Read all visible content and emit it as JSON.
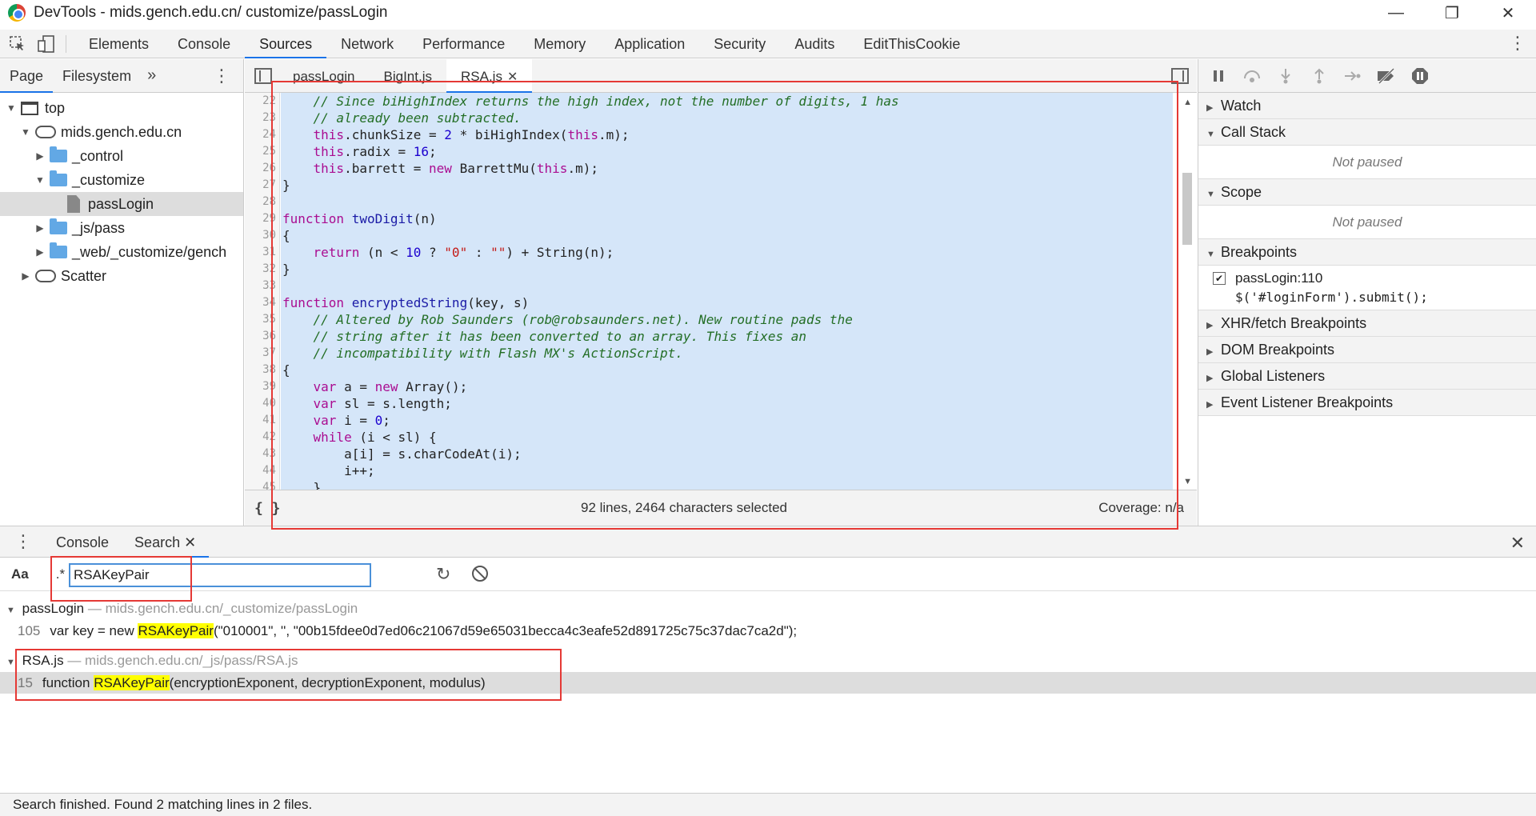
{
  "window": {
    "title": "DevTools - mids.gench.edu.cn/ customize/passLogin",
    "controls": [
      "—",
      "❐",
      "✕"
    ]
  },
  "main_tabs": [
    "Elements",
    "Console",
    "Sources",
    "Network",
    "Performance",
    "Memory",
    "Application",
    "Security",
    "Audits",
    "EditThisCookie"
  ],
  "main_tabs_active": "Sources",
  "navigator": {
    "tabs": [
      "Page",
      "Filesystem"
    ],
    "more": "»",
    "tree": [
      {
        "label": "top",
        "icon": "frame-icon",
        "expanded": true
      },
      {
        "label": "mids.gench.edu.cn",
        "icon": "cloud-icon",
        "expanded": true
      },
      {
        "label": "_control",
        "icon": "folder-icon",
        "expanded": false
      },
      {
        "label": "_customize",
        "icon": "folder-icon",
        "expanded": true
      },
      {
        "label": "passLogin",
        "icon": "file-icon",
        "selected": true
      },
      {
        "label": "_js/pass",
        "icon": "folder-icon",
        "expanded": false
      },
      {
        "label": "_web/_customize/gench",
        "icon": "folder-icon",
        "expanded": false
      },
      {
        "label": "Scatter",
        "icon": "cloud-icon",
        "expanded": false
      }
    ]
  },
  "editor": {
    "tabs": [
      {
        "label": "passLogin",
        "active": false
      },
      {
        "label": "BigInt.js",
        "active": false
      },
      {
        "label": "RSA.js",
        "active": true,
        "closable": true
      }
    ],
    "line_numbers": [
      "22",
      "23",
      "24",
      "25",
      "26",
      "27",
      "28",
      "29",
      "30",
      "31",
      "32",
      "33",
      "34",
      "35",
      "36",
      "37",
      "38",
      "39",
      "40",
      "41",
      "42",
      "43",
      "44",
      "45"
    ],
    "status": {
      "pretty_print": "{ }",
      "selection": "92 lines, 2464 characters selected",
      "coverage": "Coverage: n/a"
    }
  },
  "debugger": {
    "sections": {
      "watch": "Watch",
      "call_stack": "Call Stack",
      "call_stack_status": "Not paused",
      "scope": "Scope",
      "scope_status": "Not paused",
      "breakpoints": "Breakpoints",
      "xhr": "XHR/fetch Breakpoints",
      "dom": "DOM Breakpoints",
      "global": "Global Listeners",
      "event": "Event Listener Breakpoints"
    },
    "breakpoint": {
      "location": "passLogin:110",
      "code": "$('#loginForm').submit();",
      "checked": true
    }
  },
  "drawer": {
    "tabs": [
      "Console",
      "Search"
    ],
    "active": "Search",
    "search": {
      "case_label": "Aa",
      "regex_label": ".*",
      "query": "RSAKeyPair"
    },
    "results": [
      {
        "file": "passLogin",
        "path": "— mids.gench.edu.cn/_customize/passLogin",
        "line": "105",
        "pre": "var key = new ",
        "match": "RSAKeyPair",
        "post": "(\"010001\", '', \"00b15fdee0d7ed06c21067d59e65031becca4c3eafe52d891725c75c37dac7ca2d\");"
      },
      {
        "file": "RSA.js",
        "path": "— mids.gench.edu.cn/_js/pass/RSA.js",
        "line": "15",
        "pre": "function ",
        "match": "RSAKeyPair",
        "post": "(encryptionExponent, decryptionExponent, modulus)"
      }
    ],
    "status": "Search finished.  Found 2 matching lines in 2 files."
  },
  "colors": {
    "accent": "#1a73e8",
    "selection": "#d5e6f9",
    "highlight": "#ffff00",
    "annotation": "#e53935"
  }
}
